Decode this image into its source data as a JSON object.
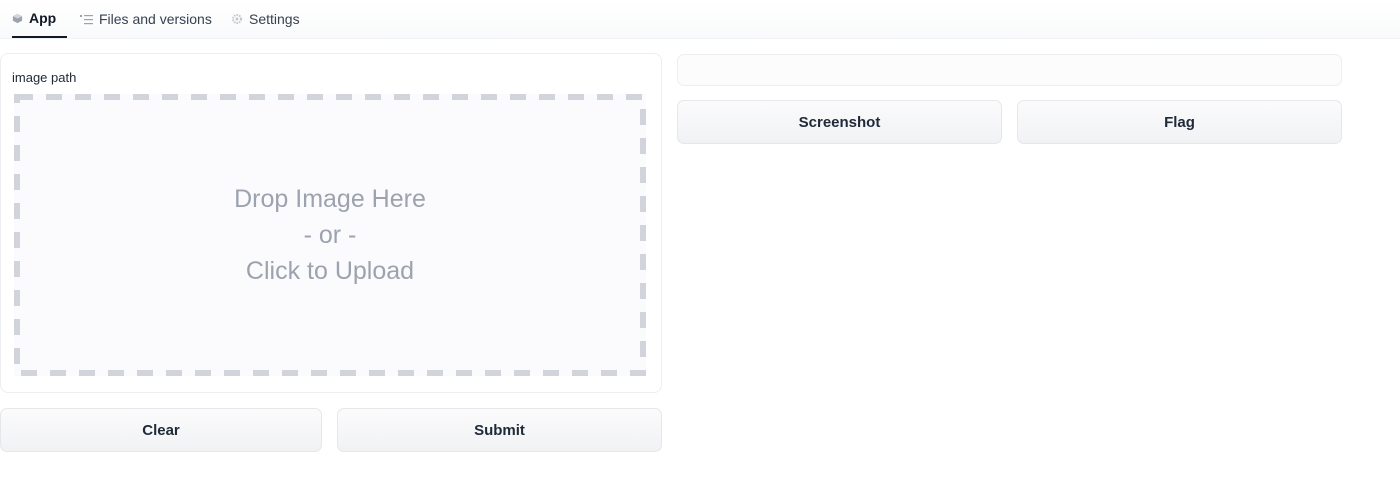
{
  "tabs": [
    {
      "label": "App",
      "icon": "cube-icon",
      "active": true
    },
    {
      "label": "Files and versions",
      "icon": "files-icon",
      "active": false
    },
    {
      "label": "Settings",
      "icon": "gear-icon",
      "active": false
    }
  ],
  "input": {
    "label": "image path",
    "drop_line1": "Drop Image Here",
    "drop_line2": "- or -",
    "drop_line3": "Click to Upload"
  },
  "actions": {
    "clear_label": "Clear",
    "submit_label": "Submit"
  },
  "output": {
    "screenshot_label": "Screenshot",
    "flag_label": "Flag"
  },
  "colors": {
    "drop_text": "#9ca3af",
    "dash": "#d1d5db"
  }
}
